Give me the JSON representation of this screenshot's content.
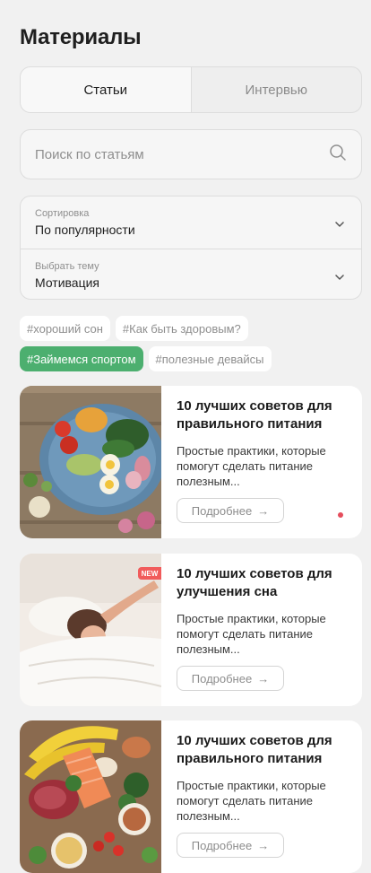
{
  "header": {
    "title": "Материалы"
  },
  "tabs": [
    {
      "label": "Статьи",
      "active": true
    },
    {
      "label": "Интервью",
      "active": false
    }
  ],
  "search": {
    "placeholder": "Поиск по статьям",
    "value": ""
  },
  "filters": {
    "sort": {
      "label": "Сортировка",
      "value": "По популярности"
    },
    "topic": {
      "label": "Выбрать тему",
      "value": "Мотивация"
    }
  },
  "tags": [
    {
      "label": "#хороший сон",
      "active": false
    },
    {
      "label": "#Как быть здоровым?",
      "active": false
    },
    {
      "label": "#Займемся спортом",
      "active": true
    },
    {
      "label": "#полезные девайсы",
      "active": false
    }
  ],
  "articles": [
    {
      "title": "10 лучших советов для правильного питания",
      "description": "Простые практики, которые помогут сделать питание полезным...",
      "button_label": "Подробнее",
      "image": "healthy-food-bowl-photo",
      "indicator": true
    },
    {
      "title": "10 лучших советов для улучшения сна",
      "description": "Простые практики, которые помогут сделать питание полезным...",
      "button_label": "Подробнее",
      "image": "sleeping-woman-photo",
      "badge": "NEW"
    },
    {
      "title": "10 лучших советов для правильного питания",
      "description": "Простые практики, которые помогут сделать питание полезным...",
      "button_label": "Подробнее",
      "image": "healthy-groceries-photo"
    }
  ],
  "colors": {
    "background": "#f1f1f1",
    "accent_green": "#4caf6f",
    "indicator_red": "#e54d5c",
    "badge_red": "#f15b5b"
  }
}
